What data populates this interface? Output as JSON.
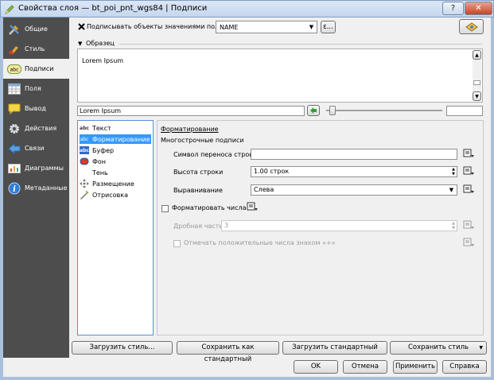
{
  "window": {
    "title": "Свойства слоя — bt_poi_pnt_wgs84 | Подписи",
    "help": "?",
    "close": "✕"
  },
  "sidebar": {
    "items": [
      {
        "label": "Общие"
      },
      {
        "label": "Стиль"
      },
      {
        "label": "Подписи"
      },
      {
        "label": "Поля"
      },
      {
        "label": "Вывод"
      },
      {
        "label": "Действия"
      },
      {
        "label": "Связи"
      },
      {
        "label": "Диаграммы"
      },
      {
        "label": "Метаданные"
      }
    ]
  },
  "top": {
    "label_checkbox": "Подписывать объекты значениями поля",
    "field_value": "NAME",
    "expr_button": "ε..."
  },
  "sample": {
    "header": "Образец",
    "preview_text": "Lorem Ipsum",
    "input_value": "Lorem Ipsum"
  },
  "tree": {
    "items": [
      {
        "label": "Текст",
        "icon": "abc"
      },
      {
        "label": "Форматирование",
        "icon": "abc"
      },
      {
        "label": "Буфер",
        "icon": "abc"
      },
      {
        "label": "Фон"
      },
      {
        "label": "Тень"
      },
      {
        "label": "Размещение"
      },
      {
        "label": "Отрисовка"
      }
    ]
  },
  "formatting": {
    "title": "Форматирование",
    "multiline_header": "Многострочные подписи",
    "wrap_label": "Символ переноса строки",
    "wrap_value": "",
    "line_height_label": "Высота строки",
    "line_height_value": "1.00 строк",
    "align_label": "Выравнивание",
    "align_value": "Слева",
    "format_numbers_label": "Форматировать числа",
    "decimals_label": "Дробная часть",
    "decimals_value": "3",
    "plus_sign_label": "Отмечать положительные числа знаком «+»"
  },
  "bottom": {
    "load_style": "Загрузить стиль...",
    "save_default": "Сохранить как стандартный",
    "load_default": "Загрузить стандартный",
    "save_style": "Сохранить стиль",
    "ok": "OK",
    "cancel": "Отмена",
    "apply": "Применить",
    "help": "Справка"
  }
}
